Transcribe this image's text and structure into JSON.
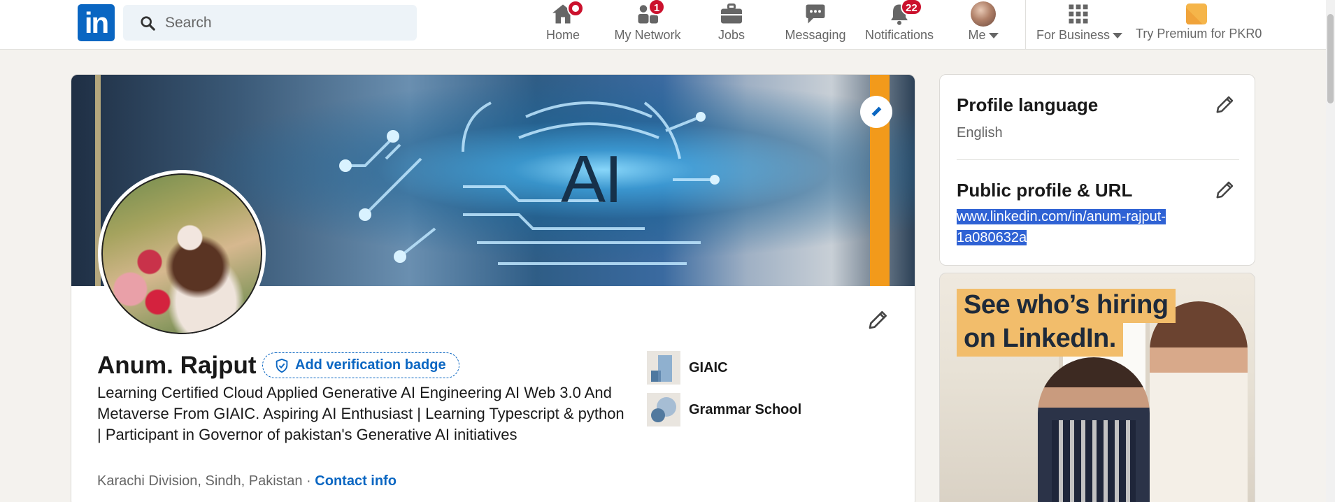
{
  "nav": {
    "search_placeholder": "Search",
    "items": [
      {
        "label": "Home",
        "icon": "home-icon"
      },
      {
        "label": "My Network",
        "icon": "network-icon",
        "badge": "1"
      },
      {
        "label": "Jobs",
        "icon": "briefcase-icon"
      },
      {
        "label": "Messaging",
        "icon": "messaging-icon"
      },
      {
        "label": "Notifications",
        "icon": "bell-icon",
        "badge": "22"
      },
      {
        "label": "Me",
        "icon": "avatar"
      },
      {
        "label": "For Business",
        "icon": "grid-icon"
      },
      {
        "label": "Try Premium for PKR0",
        "icon": "premium-icon"
      }
    ],
    "logo_text": "in"
  },
  "profile": {
    "cover_text": "AI",
    "name": "Anum. Rajput",
    "verify_label": "Add verification badge",
    "headline": "Learning Certified Cloud Applied Generative AI Engineering AI Web 3.0 And Metaverse From GIAIC. Aspiring AI Enthusiast | Learning Typescript & python | Participant in Governor of pakistan's Generative AI initiatives",
    "location": "Karachi Division, Sindh, Pakistan",
    "separator": "·",
    "contact_label": "Contact info",
    "orgs": [
      {
        "name": "GIAIC"
      },
      {
        "name": "Grammar School"
      }
    ]
  },
  "sidebar": {
    "language_title": "Profile language",
    "language_value": "English",
    "url_title": "Public profile & URL",
    "url_line1": "www.linkedin.com/in/anum-rajput-",
    "url_line2": "1a080632a"
  },
  "ad": {
    "line1": "See who’s hiring",
    "line2": "on LinkedIn."
  },
  "colors": {
    "brand": "#0a66c2",
    "badge": "#cb112d",
    "selection": "#2f62d4",
    "premium": "#f5a623"
  }
}
